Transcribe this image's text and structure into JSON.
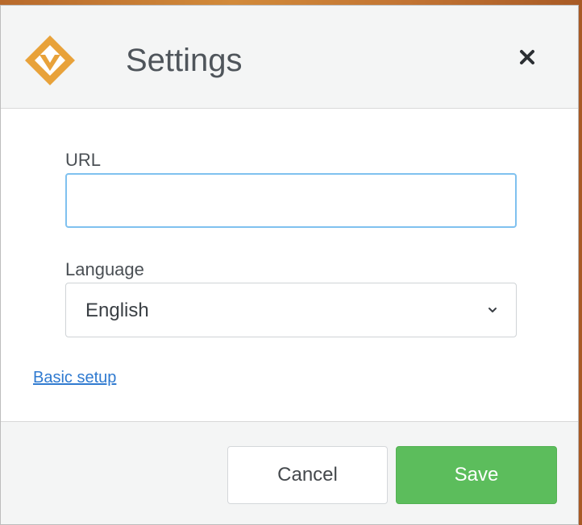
{
  "dialog": {
    "title": "Settings",
    "close_icon": "close-icon",
    "logo_icon": "orange-diamond-logo"
  },
  "form": {
    "url_label": "URL",
    "url_value": "",
    "url_placeholder": "",
    "language_label": "Language",
    "language_value": "English"
  },
  "links": {
    "basic_setup": "Basic setup"
  },
  "footer": {
    "cancel_label": "Cancel",
    "save_label": "Save"
  },
  "colors": {
    "accent_orange": "#e8a23a",
    "save_green": "#5cbd5c",
    "link_blue": "#2f7ad0",
    "input_focus": "#7fc1ef"
  }
}
